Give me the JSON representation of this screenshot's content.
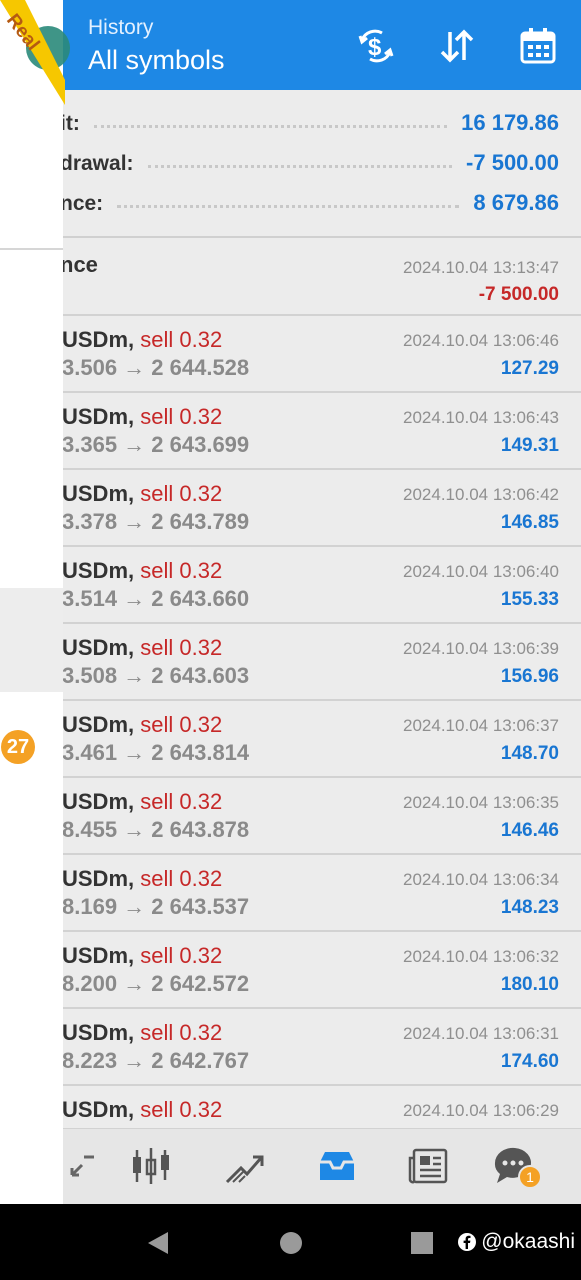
{
  "header": {
    "subtitle": "History",
    "title": "All symbols",
    "icons": [
      "exchange-dollar-icon",
      "sort-icon",
      "calendar-icon"
    ]
  },
  "ribbon": {
    "label": "Real",
    "color": "#f6c700"
  },
  "summary": [
    {
      "label": "it:",
      "value": "16 179.86"
    },
    {
      "label": "drawal:",
      "value": "-7 500.00"
    },
    {
      "label": "nce:",
      "value": "8 679.86"
    }
  ],
  "balance_row": {
    "label": "nce",
    "time": "2024.10.04 13:13:47",
    "amount": "-7 500.00"
  },
  "deals": [
    {
      "symbol": "USDm,",
      "action": "sell 0.32",
      "prices": "3.506 → 2 644.528",
      "time": "2024.10.04 13:06:46",
      "profit": "127.29"
    },
    {
      "symbol": "USDm,",
      "action": "sell 0.32",
      "prices": "3.365 → 2 643.699",
      "time": "2024.10.04 13:06:43",
      "profit": "149.31"
    },
    {
      "symbol": "USDm,",
      "action": "sell 0.32",
      "prices": "3.378 → 2 643.789",
      "time": "2024.10.04 13:06:42",
      "profit": "146.85"
    },
    {
      "symbol": "USDm,",
      "action": "sell 0.32",
      "prices": "3.514 → 2 643.660",
      "time": "2024.10.04 13:06:40",
      "profit": "155.33"
    },
    {
      "symbol": "USDm,",
      "action": "sell 0.32",
      "prices": "3.508 → 2 643.603",
      "time": "2024.10.04 13:06:39",
      "profit": "156.96"
    },
    {
      "symbol": "USDm,",
      "action": "sell 0.32",
      "prices": "3.461 → 2 643.814",
      "time": "2024.10.04 13:06:37",
      "profit": "148.70"
    },
    {
      "symbol": "USDm,",
      "action": "sell 0.32",
      "prices": "8.455 → 2 643.878",
      "time": "2024.10.04 13:06:35",
      "profit": "146.46"
    },
    {
      "symbol": "USDm,",
      "action": "sell 0.32",
      "prices": "8.169 → 2 643.537",
      "time": "2024.10.04 13:06:34",
      "profit": "148.23"
    },
    {
      "symbol": "USDm,",
      "action": "sell 0.32",
      "prices": "8.200 → 2 642.572",
      "time": "2024.10.04 13:06:32",
      "profit": "180.10"
    },
    {
      "symbol": "USDm,",
      "action": "sell 0.32",
      "prices": "8.223 → 2 642.767",
      "time": "2024.10.04 13:06:31",
      "profit": "174.60"
    },
    {
      "symbol": "USDm,",
      "action": "sell 0.32",
      "prices": "",
      "time": "2024.10.04 13:06:29",
      "profit": ""
    }
  ],
  "drawer": {
    "badge": "27"
  },
  "bottom_nav": {
    "items": [
      "quotes-icon",
      "chart-icon",
      "trade-icon",
      "history-icon",
      "news-icon",
      "chat-icon"
    ],
    "active": "history-icon",
    "chat_badge": "1"
  },
  "watermark": {
    "text": "@okaashi",
    "icon": "facebook-icon"
  },
  "colors": {
    "accent": "#1e88e5",
    "profit": "#1976d2",
    "loss": "#c62828",
    "badge": "#f4a125"
  }
}
